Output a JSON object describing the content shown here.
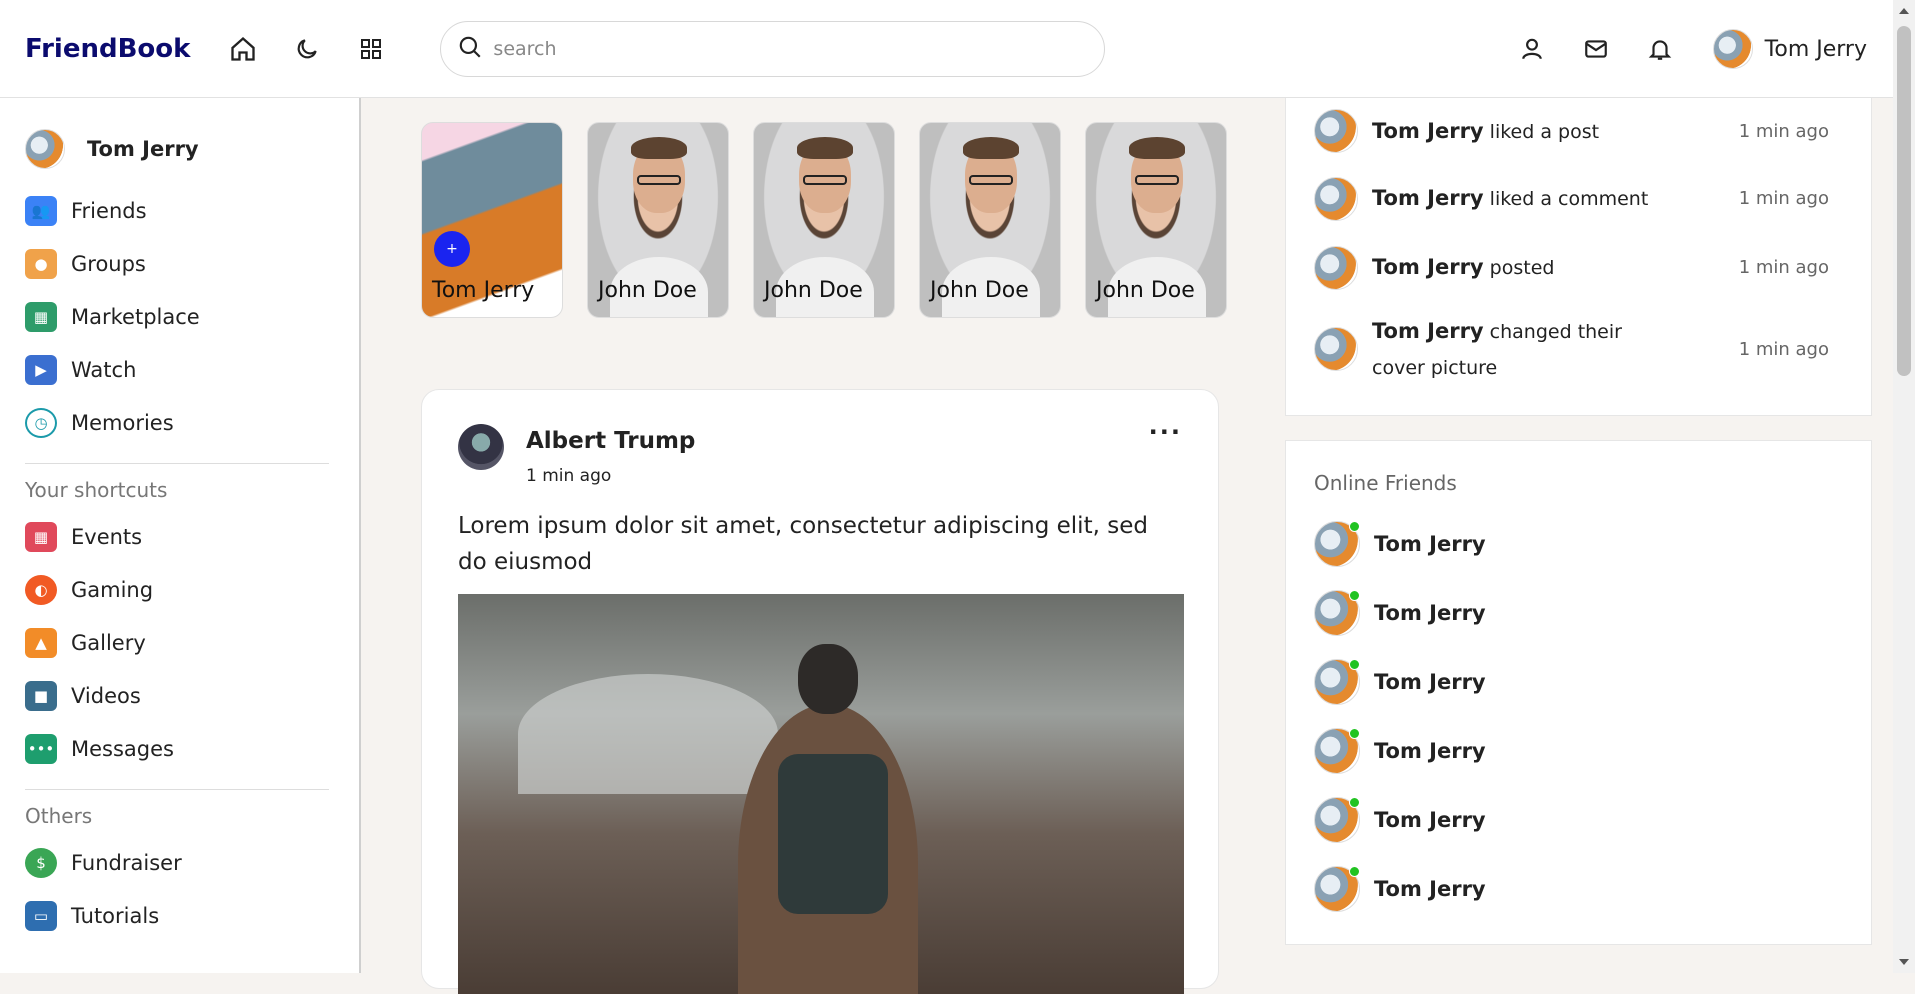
{
  "navbar": {
    "logo": "FriendBook",
    "search_placeholder": "search",
    "user_name": "Tom Jerry",
    "icons": [
      "home-icon",
      "moon-icon",
      "grid-icon",
      "search-icon",
      "user-icon",
      "mail-icon",
      "bell-icon"
    ]
  },
  "sidebar": {
    "user_name": "Tom Jerry",
    "menu": [
      {
        "label": "Friends",
        "icon": "friends-icon",
        "color": "#3b82f6"
      },
      {
        "label": "Groups",
        "icon": "groups-icon",
        "color": "#f0a24a"
      },
      {
        "label": "Marketplace",
        "icon": "marketplace-icon",
        "color": "#2e9c6a"
      },
      {
        "label": "Watch",
        "icon": "watch-icon",
        "color": "#3b6fd0"
      },
      {
        "label": "Memories",
        "icon": "memories-icon",
        "color": "#1b9aaa"
      }
    ],
    "shortcuts_title": "Your shortcuts",
    "shortcuts": [
      {
        "label": "Events",
        "icon": "events-icon",
        "color": "#e0495b"
      },
      {
        "label": "Gaming",
        "icon": "gaming-icon",
        "color": "#f15a24"
      },
      {
        "label": "Gallery",
        "icon": "gallery-icon",
        "color": "#f28c28"
      },
      {
        "label": "Videos",
        "icon": "videos-icon",
        "color": "#3a6d8c"
      },
      {
        "label": "Messages",
        "icon": "messages-icon",
        "color": "#1e9e6e"
      }
    ],
    "others_title": "Others",
    "others": [
      {
        "label": "Fundraiser",
        "icon": "fundraiser-icon",
        "color": "#3aa655"
      },
      {
        "label": "Tutorials",
        "icon": "tutorials-icon",
        "color": "#2e6eb0"
      }
    ]
  },
  "stories": [
    {
      "name": "Tom Jerry",
      "mine": true,
      "add_label": "+"
    },
    {
      "name": "John Doe"
    },
    {
      "name": "John Doe"
    },
    {
      "name": "John Doe"
    },
    {
      "name": "John Doe"
    }
  ],
  "post": {
    "author": "Albert Trump",
    "time": "1 min ago",
    "more": "···",
    "text": "Lorem ipsum dolor sit amet, consectetur adipiscing elit, sed do eiusmod"
  },
  "activity": [
    {
      "user": "Tom Jerry",
      "action": "liked a post",
      "time": "1 min ago"
    },
    {
      "user": "Tom Jerry",
      "action": "liked a comment",
      "time": "1 min ago"
    },
    {
      "user": "Tom Jerry",
      "action": "posted",
      "time": "1 min ago"
    },
    {
      "user": "Tom Jerry",
      "action": "changed their cover picture",
      "time": "1 min ago"
    }
  ],
  "online": {
    "title": "Online Friends",
    "friends": [
      "Tom Jerry",
      "Tom Jerry",
      "Tom Jerry",
      "Tom Jerry",
      "Tom Jerry",
      "Tom Jerry"
    ],
    "status_color": "#21c321"
  },
  "colors": {
    "logo": "#0b0b6e",
    "story_add": "#1a24f0",
    "online_dot": "#21c321"
  }
}
